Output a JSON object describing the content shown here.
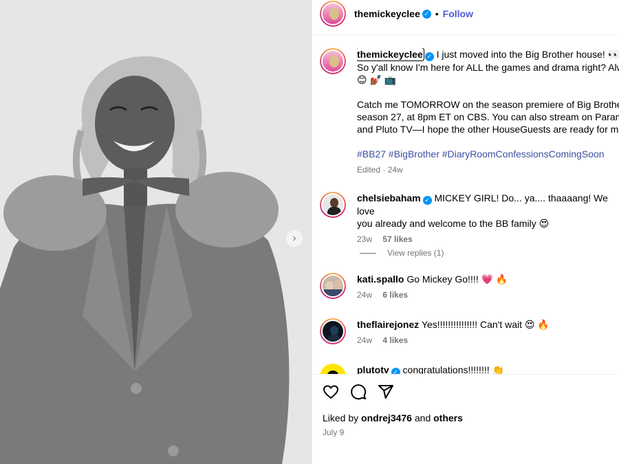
{
  "post": {
    "author": "themickeyclee",
    "follow_label": "Follow",
    "separator": "•"
  },
  "caption": {
    "username": "themickeyclee",
    "line1": "I just moved into the Big Brother house! 👀 ",
    "line2": "So y'all know I'm here for ALL the games and drama right? Alw",
    "line3": "😊 💅🏾 📺",
    "para2_line1": "Catch me TOMORROW on the season premiere of Big Brother,",
    "para2_line2": "season 27, at 8pm ET on CBS. You can also stream on Paramou",
    "para2_line3": "and Pluto TV—I hope the other HouseGuests are ready for me",
    "hashtags": "#BB27 #BigBrother #DiaryRoomConfessionsComingSoon",
    "meta": "Edited · 24w"
  },
  "comments": [
    {
      "username": "chelsiebaham",
      "verified": true,
      "text_line1": "MICKEY GIRL! Do... ya.... thaaaang! We love",
      "text_line2": "you already and welcome to the BB family 😍",
      "age": "23w",
      "likes": "57 likes"
    },
    {
      "username": "kati.spallo",
      "verified": false,
      "text_line1": "Go Mickey Go!!!! 💗 🔥",
      "age": "24w",
      "likes": "6 likes"
    },
    {
      "username": "theflairejonez",
      "verified": false,
      "text_line1": "Yes!!!!!!!!!!!!!!! Can't wait 😍 🔥",
      "age": "24w",
      "likes": "4 likes"
    },
    {
      "username": "plutotv",
      "verified": true,
      "text_line1": "congratulations!!!!!!!! 👏"
    }
  ],
  "view_replies": "View replies (1)",
  "liked_by": {
    "prefix": "Liked by ",
    "user": "ondrej3476",
    "mid": " and ",
    "others": "others"
  },
  "date": "July 9",
  "icons": [
    "heart-icon",
    "comment-icon",
    "share-icon",
    "verified-icon",
    "chevron-right-icon"
  ],
  "colors": {
    "accent_link": "#4f5bd5",
    "hashtag": "#3c4fa3",
    "verified": "#0095f6",
    "muted": "#737373"
  }
}
